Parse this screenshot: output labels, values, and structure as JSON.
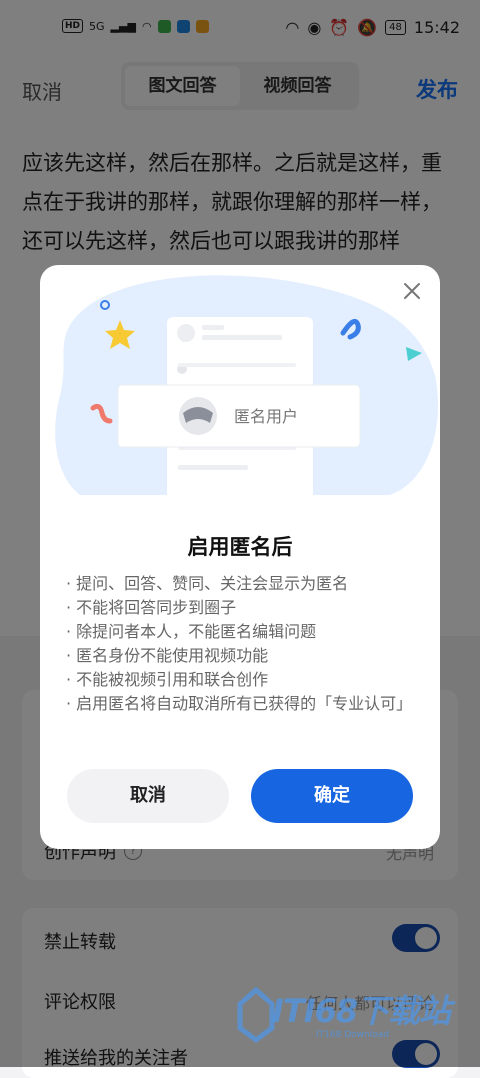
{
  "status_bar": {
    "left_badges": [
      "HD",
      "5G"
    ],
    "time": "15:42",
    "battery": "48"
  },
  "nav": {
    "cancel": "取消",
    "tabs": [
      {
        "label": "图文回答",
        "active": true
      },
      {
        "label": "视频回答",
        "active": false
      }
    ],
    "publish": "发布"
  },
  "content": {
    "body_text": "应该先这样，然后在那样。之后就是这样，重点在于我讲的那样，就跟你理解的那样一样，还可以先这样，然后也可以跟我讲的那样"
  },
  "settings_card1": {
    "creation_label": "创作声明",
    "creation_value": "无声明"
  },
  "settings_card2": {
    "no_repost_label": "禁止转载",
    "comment_perm_label": "评论权限",
    "comment_perm_value": "任何人都可以评论",
    "push_label": "推送给我的关注者"
  },
  "dialog": {
    "illustration_user_label": "匿名用户",
    "title": "启用匿名后",
    "items": [
      "提问、回答、赞同、关注会显示为匿名",
      "不能将回答同步到圈子",
      "除提问者本人，不能匿名编辑问题",
      "匿名身份不能使用视频功能",
      "不能被视频引用和联合创作",
      "启用匿名将自动取消所有已获得的「专业认可」"
    ],
    "cancel": "取消",
    "confirm": "确定"
  },
  "watermark": {
    "text": "ITI68下载站",
    "sub": "IT168 Download"
  },
  "colors": {
    "accent": "#1765e0",
    "publish": "#1772f6",
    "toggle": "#1a4db0"
  }
}
